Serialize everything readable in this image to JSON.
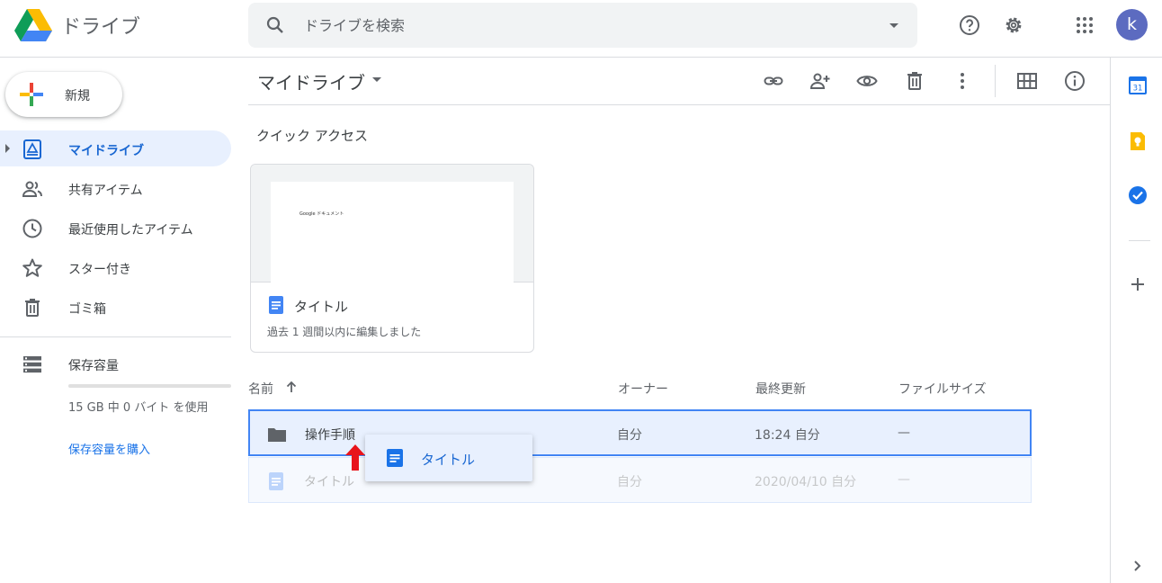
{
  "header": {
    "app_title": "ドライブ",
    "search_placeholder": "ドライブを検索",
    "avatar_letter": "k"
  },
  "sidebar": {
    "new_label": "新規",
    "items": [
      {
        "label": "マイドライブ",
        "icon": "my-drive-icon",
        "active": true
      },
      {
        "label": "共有アイテム",
        "icon": "shared-icon"
      },
      {
        "label": "最近使用したアイテム",
        "icon": "clock-icon"
      },
      {
        "label": "スター付き",
        "icon": "star-icon"
      },
      {
        "label": "ゴミ箱",
        "icon": "trash-icon"
      }
    ],
    "storage": {
      "label": "保存容量",
      "usage_text": "15 GB 中 0 バイト を使用",
      "buy_label": "保存容量を購入"
    }
  },
  "main": {
    "breadcrumb": "マイドライブ",
    "quick_access": {
      "title": "クイック アクセス",
      "card": {
        "thumbnail_text": "Google ドキュメント",
        "title": "タイトル",
        "subtitle": "過去 1 週間以内に編集しました"
      }
    },
    "columns": {
      "name": "名前",
      "owner": "オーナー",
      "modified": "最終更新",
      "size": "ファイルサイズ"
    },
    "rows": [
      {
        "name": "操作手順",
        "type": "folder",
        "owner": "自分",
        "modified": "18:24 自分",
        "size": "—"
      },
      {
        "name": "タイトル",
        "type": "doc",
        "owner": "自分",
        "modified": "2020/04/10 自分",
        "size": "—"
      }
    ],
    "drag_chip_label": "タイトル"
  },
  "colors": {
    "accent": "#1a73e8",
    "active_bg": "#e8f0fe",
    "selected_border": "#4285f4"
  }
}
